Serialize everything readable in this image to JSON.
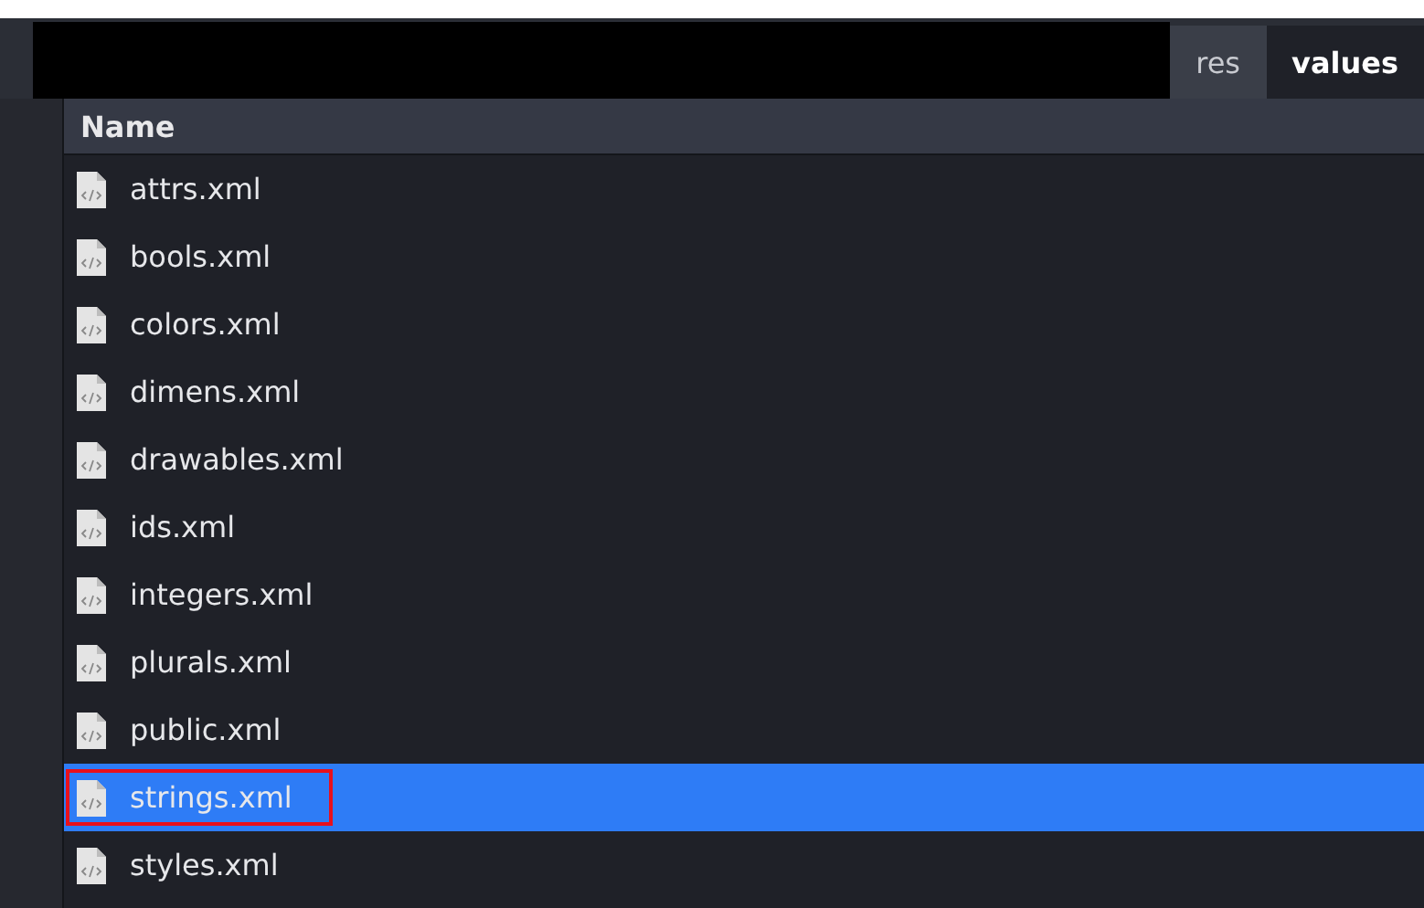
{
  "path_bar": {
    "crumbs": [
      {
        "label": "res",
        "selected": false
      },
      {
        "label": "values",
        "selected": true
      }
    ]
  },
  "file_list": {
    "column": "Name",
    "files": [
      {
        "name": "attrs.xml",
        "selected": false,
        "highlighted": false
      },
      {
        "name": "bools.xml",
        "selected": false,
        "highlighted": false
      },
      {
        "name": "colors.xml",
        "selected": false,
        "highlighted": false
      },
      {
        "name": "dimens.xml",
        "selected": false,
        "highlighted": false
      },
      {
        "name": "drawables.xml",
        "selected": false,
        "highlighted": false
      },
      {
        "name": "ids.xml",
        "selected": false,
        "highlighted": false
      },
      {
        "name": "integers.xml",
        "selected": false,
        "highlighted": false
      },
      {
        "name": "plurals.xml",
        "selected": false,
        "highlighted": false
      },
      {
        "name": "public.xml",
        "selected": false,
        "highlighted": false
      },
      {
        "name": "strings.xml",
        "selected": true,
        "highlighted": true
      },
      {
        "name": "styles.xml",
        "selected": false,
        "highlighted": false
      }
    ]
  }
}
